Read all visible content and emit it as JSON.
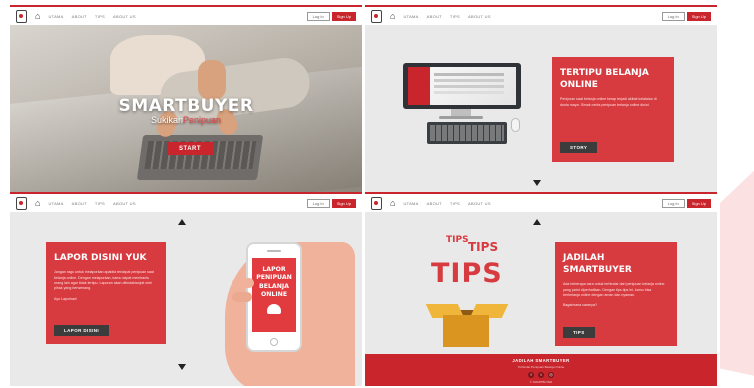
{
  "nav": {
    "links": [
      "UTAMA",
      "ABOUT",
      "TIPS",
      "ABOUT US"
    ],
    "login_label": "Log In",
    "signup_label": "Sign Up"
  },
  "hero": {
    "title": "SMARTBUYER",
    "subtitle_prefix": "Sukikan",
    "subtitle_highlight": "Penipuan",
    "start_label": "START"
  },
  "story": {
    "title": "TERTIPU BELANJA ONLINE",
    "text": "Penipuan saat belanja online kerap terjadi akibat kelalaian di dunia maya. Simak cerita penipuan belanja online disini.",
    "button_label": "STORY"
  },
  "lapor": {
    "title": "LAPOR DISINI YUK",
    "text": "Jangan ragu untuk melaporkan apabila terdapat penipuan saat belanja online. Dengan melaporkan, kamu dapat membantu orang lain agar tidak tertipu. Laporan akan ditindaklanjuti oleh pihak yang berwenang.",
    "link_text": "Ayo Laporkan!",
    "button_label": "LAPOR DISINI",
    "phone_text": [
      "LAPOR",
      "PENIPUAN",
      "BELANJA",
      "ONLINE"
    ]
  },
  "tips": {
    "small1": "TIPS",
    "small2": "TIPS",
    "big": "TIPS",
    "title": "JADILAH SMARTBUYER",
    "text": "Ada beberapa cara untuk terhindar dari penipuan belanja online yang patut diperhatikan. Dengan tips-tips ini, kamu bisa berbelanja online dengan aman dan nyaman.",
    "link_text": "Bagaimana caranya?",
    "button_label": "TIPS"
  },
  "footer": {
    "title": "JADILAH SMARTBUYER",
    "subtitle": "Terhindar Penipuan Belanja Online",
    "icons": [
      "facebook-icon",
      "twitter-icon",
      "instagram-icon"
    ],
    "copyright": "© SMARTBUYER"
  },
  "colors": {
    "accent": "#c8262c",
    "card": "#d73a3f",
    "dark_button": "#3c3c3c",
    "panel_bg": "#e9e9e9"
  }
}
